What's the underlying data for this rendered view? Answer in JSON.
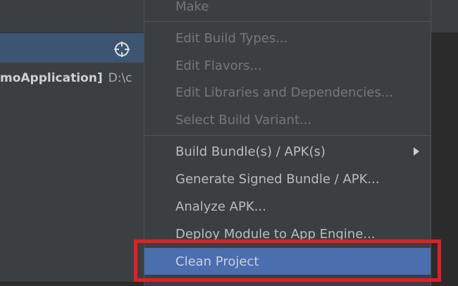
{
  "project_tree": {
    "module_label": "moApplication]",
    "module_path": "D:\\c"
  },
  "icons": {
    "locate": "crosshair-target-icon",
    "submenu": "chevron-right-icon"
  },
  "menu": {
    "make": "Make",
    "edit_build_types": "Edit Build Types...",
    "edit_flavors": "Edit Flavors...",
    "edit_libraries": "Edit Libraries and Dependencies...",
    "select_build_variant": "Select Build Variant...",
    "build_bundle_apk": "Build Bundle(s) / APK(s)",
    "generate_signed": "Generate Signed Bundle / APK...",
    "analyze_apk": "Analyze APK...",
    "deploy_module": "Deploy Module to App Engine...",
    "clean_project": "Clean Project"
  },
  "colors": {
    "menu_bg": "#3c3f41",
    "selection": "#4b6eaf",
    "highlight_border": "#e01f26",
    "disabled_text": "#777777"
  }
}
